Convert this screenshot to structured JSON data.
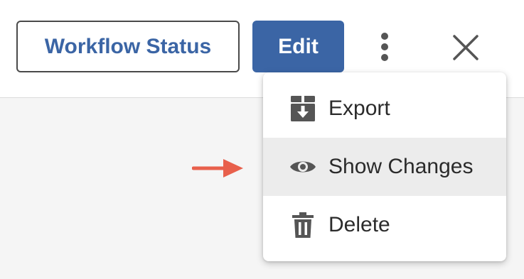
{
  "toolbar": {
    "workflow_status_label": "Workflow Status",
    "edit_label": "Edit"
  },
  "menu": {
    "items": [
      {
        "label": "Export",
        "icon": "export-icon"
      },
      {
        "label": "Show Changes",
        "icon": "eye-icon",
        "highlighted": true
      },
      {
        "label": "Delete",
        "icon": "trash-icon"
      }
    ]
  },
  "colors": {
    "primary": "#3b65a5",
    "icon": "#555555",
    "annotation_arrow": "#e8604c",
    "menu_highlight": "#ececec"
  }
}
